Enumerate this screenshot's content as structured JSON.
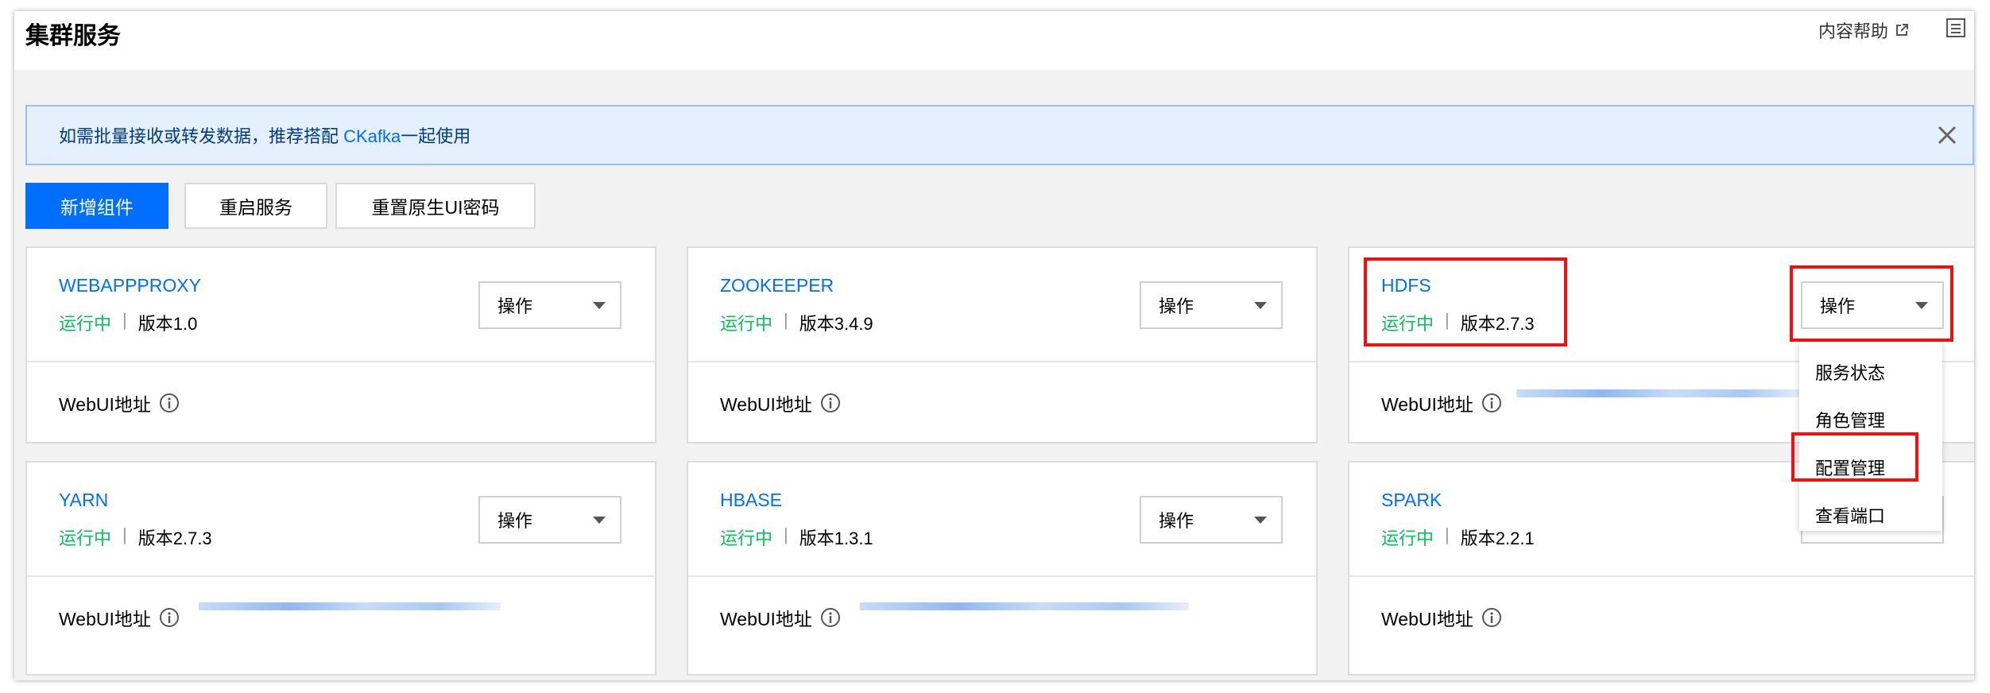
{
  "header": {
    "title": "集群服务",
    "help_label": "内容帮助",
    "icons": [
      "external-link-icon",
      "list-icon"
    ]
  },
  "notice": {
    "text_before": "如需批量接收或转发数据，推荐搭配 ",
    "link": "CKafka",
    "text_after": "一起使用",
    "close_icon": "close-icon"
  },
  "toolbar": {
    "add_label": "新增组件",
    "restart_label": "重启服务",
    "reset_label": "重置原生UI密码"
  },
  "common": {
    "status": "运行中",
    "separator": "|",
    "ops_label": "操作",
    "webui_label": "WebUI地址"
  },
  "services": [
    {
      "name": "WEBAPPPROXY",
      "version": "版本1.0"
    },
    {
      "name": "ZOOKEEPER",
      "version": "版本3.4.9"
    },
    {
      "name": "HDFS",
      "version": "版本2.7.3"
    },
    {
      "name": "YARN",
      "version": "版本2.7.3"
    },
    {
      "name": "HBASE",
      "version": "版本1.3.1"
    },
    {
      "name": "SPARK",
      "version": "版本2.2.1"
    }
  ],
  "dropdown": {
    "items": [
      "服务状态",
      "角色管理",
      "配置管理",
      "查看端口"
    ],
    "highlighted": "配置管理"
  },
  "colors": {
    "accent": "#006eff",
    "running": "#0abf5b",
    "highlight_box": "#f20f0f"
  }
}
